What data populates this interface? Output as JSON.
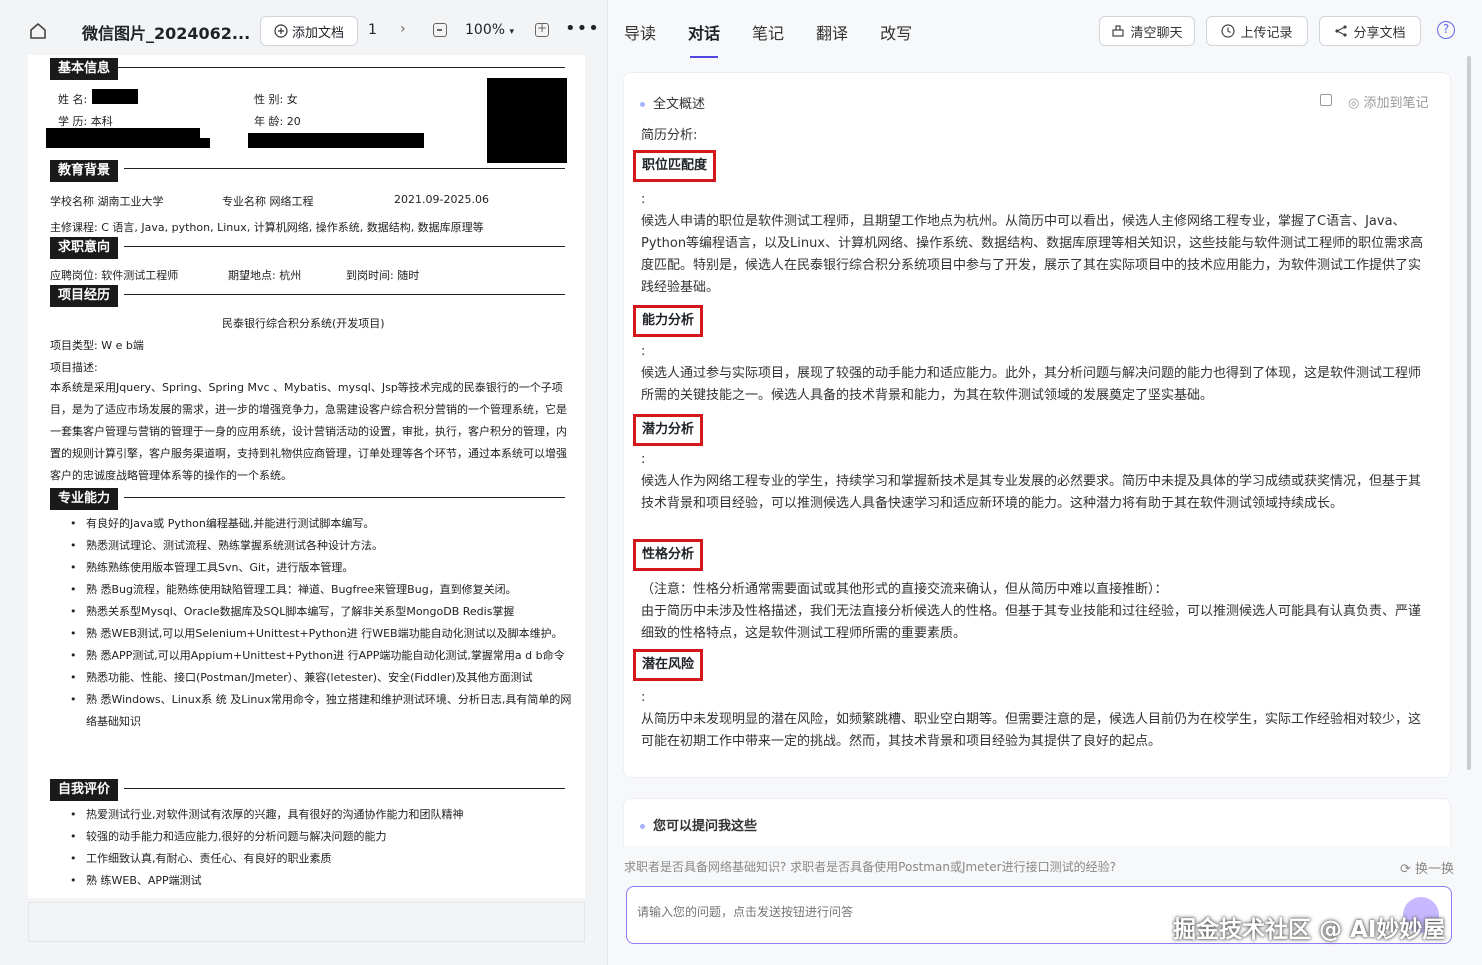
{
  "toolbar": {
    "title": "微信图片_2024062...",
    "add_doc": "添加文档",
    "page": "1",
    "zoom": "100%"
  },
  "resume": {
    "basic_header": "基本信息",
    "name_label": "姓 名:",
    "gender": "性 别:  女",
    "education_label": "学 历:  本科",
    "age": "年 龄:  20",
    "edu_header": "教育背景",
    "school": "学校名称  湖南工业大学",
    "major": "专业名称  网络工程",
    "period": "2021.09-2025.06",
    "courses": "主修课程:  C 语言,  Java,  python,  Linux,  计算机网络,  操作系统,  数据结构,  数据库原理等",
    "intent_header": "求职意向",
    "position": "应聘岗位:  软件测试工程师",
    "location": "期望地点:  杭州",
    "arrival": "到岗时间:  随时",
    "project_header": "项目经历",
    "project_name": "民泰银行综合积分系统(开发项目)",
    "project_type": "项目类型:  W e b端",
    "project_desc_label": "项目描述:",
    "project_desc": "本系统是采用Jquery、Spring、Spring Mvc 、Mybatis、mysql、Jsp等技术完成的民泰银行的一个子项目，是为了适应市场发展的需求，进一步的增强竞争力，急需建设客户综合积分营销的一个管理系统，它是一套集客户管理与营销的管理于一身的应用系统，设计营销活动的设置，审批，执行，客户积分的管理，内置的规则计算引擎，客户服务渠道啊，支持到礼物供应商管理，订单处理等各个环节，通过本系统可以增强客户的忠诚度战略管理体系等的操作的一个系统。",
    "skills_header": "专业能力",
    "skills": [
      "有良好的Java或 Python编程基础,并能进行测试脚本编写。",
      "熟悉测试理论、测试流程、熟练掌握系统测试各种设计方法。",
      "熟练熟练使用版本管理工具Svn、Git，进行版本管理。",
      "熟 悉Bug流程，能熟练使用缺陷管理工具：禅道、Bugfree来管理Bug，直到修复关闭。",
      "熟悉关系型Mysql、Oracle数据库及SQL脚本编写，了解非关系型MongoDB Redis掌握",
      "熟 悉WEB测试,可以用Selenium+Unittest+Python进 行WEB端功能自动化测试以及脚本维护。",
      "熟 悉APP测试,可以用Appium+Unittest+Python进 行APP端功能自动化测试,掌握常用a d b命令",
      "熟悉功能、性能、接口(Postman/Jmeter）、兼容(letester)、安全(Fiddler)及其他方面测试",
      "熟 悉Windows、Linux系 统 及Linux常用命令，独立搭建和维护测试环境、分析日志,具有简单的网络基础知识"
    ],
    "self_header": "自我评价",
    "self_eval": [
      "热爱测试行业,对软件测试有浓厚的兴趣，具有很好的沟通协作能力和团队精神",
      "较强的动手能力和适应能力,很好的分析问题与解决问题的能力",
      "工作细致认真,有耐心、责任心、有良好的职业素质",
      "熟 练WEB、APP端测试"
    ]
  },
  "right": {
    "tabs": [
      "导读",
      "对话",
      "笔记",
      "翻译",
      "改写"
    ],
    "active_tab": "对话",
    "clear_chat": "清空聊天",
    "upload_records": "上传记录",
    "share_doc": "分享文档",
    "help": "?",
    "summary_title": "全文概述",
    "add_to_notes": "添加到笔记",
    "intro": "简历分析:",
    "sections": [
      {
        "heading": "职位匹配度",
        "colon": ":",
        "body": "候选人申请的职位是软件测试工程师，且期望工作地点为杭州。从简历中可以看出，候选人主修网络工程专业，掌握了C语言、Java、Python等编程语言，以及Linux、计算机网络、操作系统、数据结构、数据库原理等相关知识，这些技能与软件测试工程师的职位需求高度匹配。特别是，候选人在民泰银行综合积分系统项目中参与了开发，展示了其在实际项目中的技术应用能力，为软件测试工作提供了实践经验基础。"
      },
      {
        "heading": "能力分析",
        "colon": ":",
        "body": "候选人通过参与实际项目，展现了较强的动手能力和适应能力。此外，其分析问题与解决问题的能力也得到了体现，这是软件测试工程师所需的关键技能之一。候选人具备的技术背景和能力，为其在软件测试领域的发展奠定了坚实基础。"
      },
      {
        "heading": "潜力分析",
        "colon": ":",
        "body": "候选人作为网络工程专业的学生，持续学习和掌握新技术是其专业发展的必然要求。简历中未提及具体的学习成绩或获奖情况，但基于其技术背景和项目经验，可以推测候选人具备快速学习和适应新环境的能力。这种潜力将有助于其在软件测试领域持续成长。"
      },
      {
        "heading": "性格分析",
        "colon": "（注意：性格分析通常需要面试或其他形式的直接交流来确认，但从简历中难以直接推断）：",
        "body": "由于简历中未涉及性格描述，我们无法直接分析候选人的性格。但基于其专业技能和过往经验，可以推测候选人可能具有认真负责、严谨细致的性格特点，这是软件测试工程师所需的重要素质。"
      },
      {
        "heading": "潜在风险",
        "colon": ":",
        "body": "从简历中未发现明显的潜在风险，如频繁跳槽、职业空白期等。但需要注意的是，候选人目前仍为在校学生，实际工作经验相对较少，这可能在初期工作中带来一定的挑战。然而，其技术背景和项目经验为其提供了良好的起点。"
      }
    ],
    "ask_title": "您可以提问我这些",
    "suggestions": "求职者是否具备网络基础知识?   求职者是否具备使用Postman或Jmeter进行接口测试的经验?",
    "refresh": "换一换",
    "input_placeholder": "请输入您的问题，点击发送按钮进行问答",
    "watermark": "掘金技术社区 @ AI妙妙屋"
  },
  "colors": {
    "accent": "#4f46e5",
    "highlight_box": "#d4171a",
    "input_border": "#8b7cf6"
  }
}
